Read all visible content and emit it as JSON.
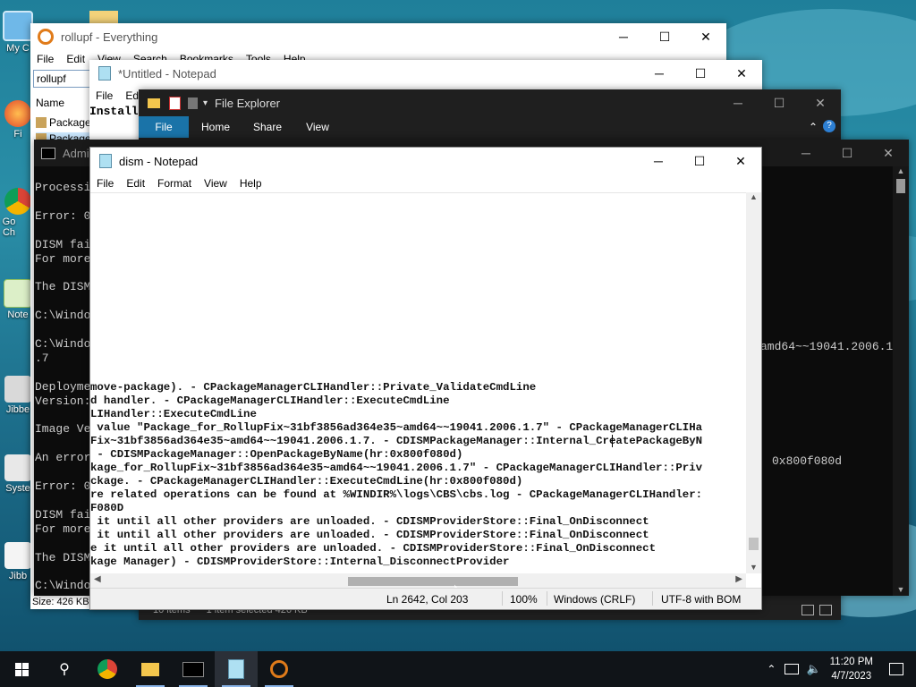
{
  "desktop": {
    "icons": [
      {
        "label": "My C"
      },
      {
        "label": "Fi"
      },
      {
        "label": "Go Ch"
      },
      {
        "label": "Note"
      },
      {
        "label": "Jibbe"
      },
      {
        "label": "Syste"
      },
      {
        "label": "Jibb"
      }
    ]
  },
  "everything": {
    "title": "rollupf - Everything",
    "menu": [
      "File",
      "Edit",
      "View",
      "Search",
      "Bookmarks",
      "Tools",
      "Help"
    ],
    "search_value": "rollupf",
    "column_name": "Name",
    "rows": [
      "Package",
      "Package"
    ],
    "status": "Size: 426 KB,"
  },
  "notepad_untitled": {
    "title": "*Untitled - Notepad",
    "menu": [
      "File",
      "Edit"
    ],
    "text": "Install"
  },
  "explorer": {
    "title": "File Explorer",
    "tabs": [
      "File",
      "Home",
      "Share",
      "View"
    ],
    "status_items": "10 items",
    "status_selected": "1 item selected  426 KB"
  },
  "cmd": {
    "title": "Admi",
    "lines": [
      "Processi",
      "",
      "Error: 0",
      "",
      "DISM fai",
      "For more",
      "",
      "The DISM",
      "",
      "C:\\Windo",
      "",
      "C:\\Windo",
      ".7",
      "",
      "Deployme",
      "Version:",
      "",
      "Image Ve",
      "",
      "An error",
      "",
      "Error: 0",
      "",
      "DISM fai",
      "For more",
      "",
      "The DISM",
      "",
      "C:\\Windo"
    ],
    "right_text_1": "amd64~~19041.2006.1",
    "right_text_2": "0x800f080d"
  },
  "dism_notepad": {
    "title": "dism - Notepad",
    "menu": [
      "File",
      "Edit",
      "Format",
      "View",
      "Help"
    ],
    "lines": [
      "move-package). - CPackageManagerCLIHandler::Private_ValidateCmdLine",
      "d handler. - CPackageManagerCLIHandler::ExecuteCmdLine",
      "LIHandler::ExecuteCmdLine",
      " value \"Package_for_RollupFix~31bf3856ad364e35~amd64~~19041.2006.1.7\" - CPackageManagerCLIHa",
      "Fix~31bf3856ad364e35~amd64~~19041.2006.1.7. - CDISMPackageManager::Internal_CreatePackageByN",
      " - CDISMPackageManager::OpenPackageByName(hr:0x800f080d)",
      "kage_for_RollupFix~31bf3856ad364e35~amd64~~19041.2006.1.7\" - CPackageManagerCLIHandler::Priv",
      "ckage. - CPackageManagerCLIHandler::ExecuteCmdLine(hr:0x800f080d)",
      "re related operations can be found at %WINDIR%\\logs\\CBS\\cbs.log - CPackageManagerCLIHandler:",
      "F080D",
      " it until all other providers are unloaded. - CDISMProviderStore::Final_OnDisconnect",
      " it until all other providers are unloaded. - CDISMProviderStore::Final_OnDisconnect",
      "e it until all other providers are unloaded. - CDISMProviderStore::Final_OnDisconnect",
      "kage Manager) - CDISMProviderStore::Internal_DisconnectProvider"
    ],
    "status": {
      "position": "Ln 2642, Col 203",
      "zoom": "100%",
      "line_endings": "Windows (CRLF)",
      "encoding": "UTF-8 with BOM"
    }
  },
  "taskbar": {
    "time": "11:20 PM",
    "date": "4/7/2023"
  },
  "colors": {
    "explorer_ribbon": "#1f1f1f",
    "explorer_file_tab": "#1a73a8",
    "cmd_bg": "#0c0c0c",
    "taskbar": "#101418",
    "desktop": "#1f7f9a"
  }
}
